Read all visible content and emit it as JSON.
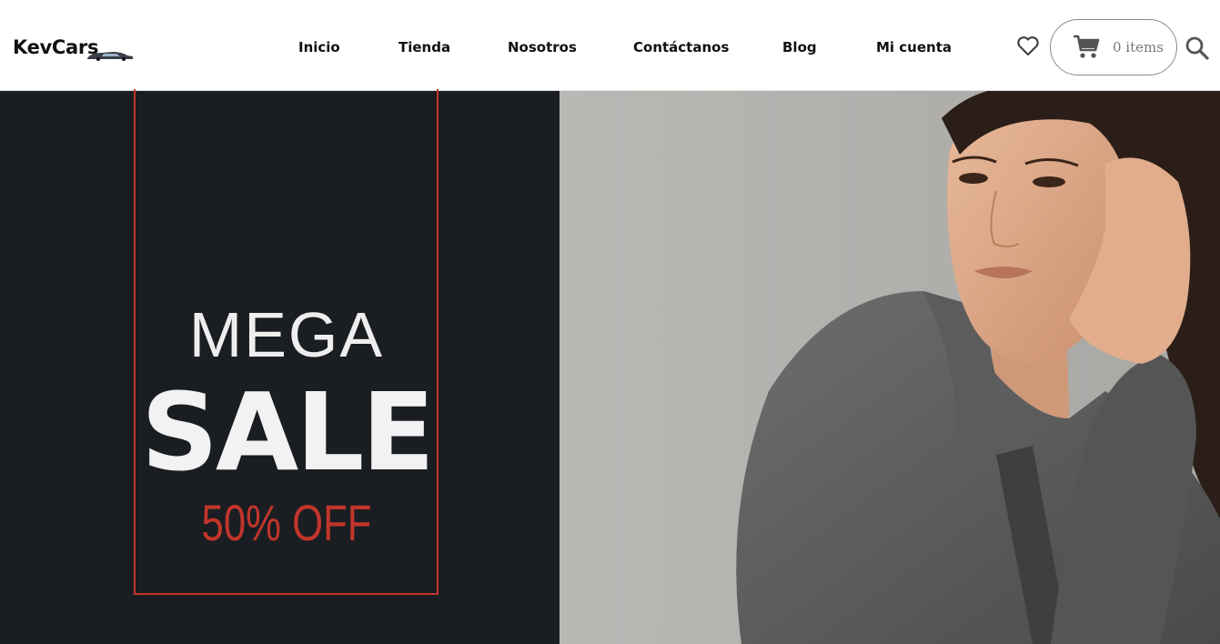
{
  "header": {
    "logo": "KevCars",
    "nav": [
      {
        "label": "Inicio"
      },
      {
        "label": "Tienda"
      },
      {
        "label": "Nosotros"
      },
      {
        "label": "Contáctanos"
      },
      {
        "label": "Blog"
      },
      {
        "label": "Mi cuenta"
      }
    ],
    "wishlist_icon": "heart-icon",
    "cart": {
      "icon": "cart-icon",
      "text": "0 items"
    },
    "search_icon": "search-icon"
  },
  "hero": {
    "line1": "MEGA",
    "line2": "SALE",
    "line3": "50% OFF",
    "image": "woman-in-gray-blazer-photo"
  },
  "colors": {
    "hero_bg": "#1a1d22",
    "accent_red": "#c0352b",
    "photo_bg": "#b7b6b3"
  }
}
